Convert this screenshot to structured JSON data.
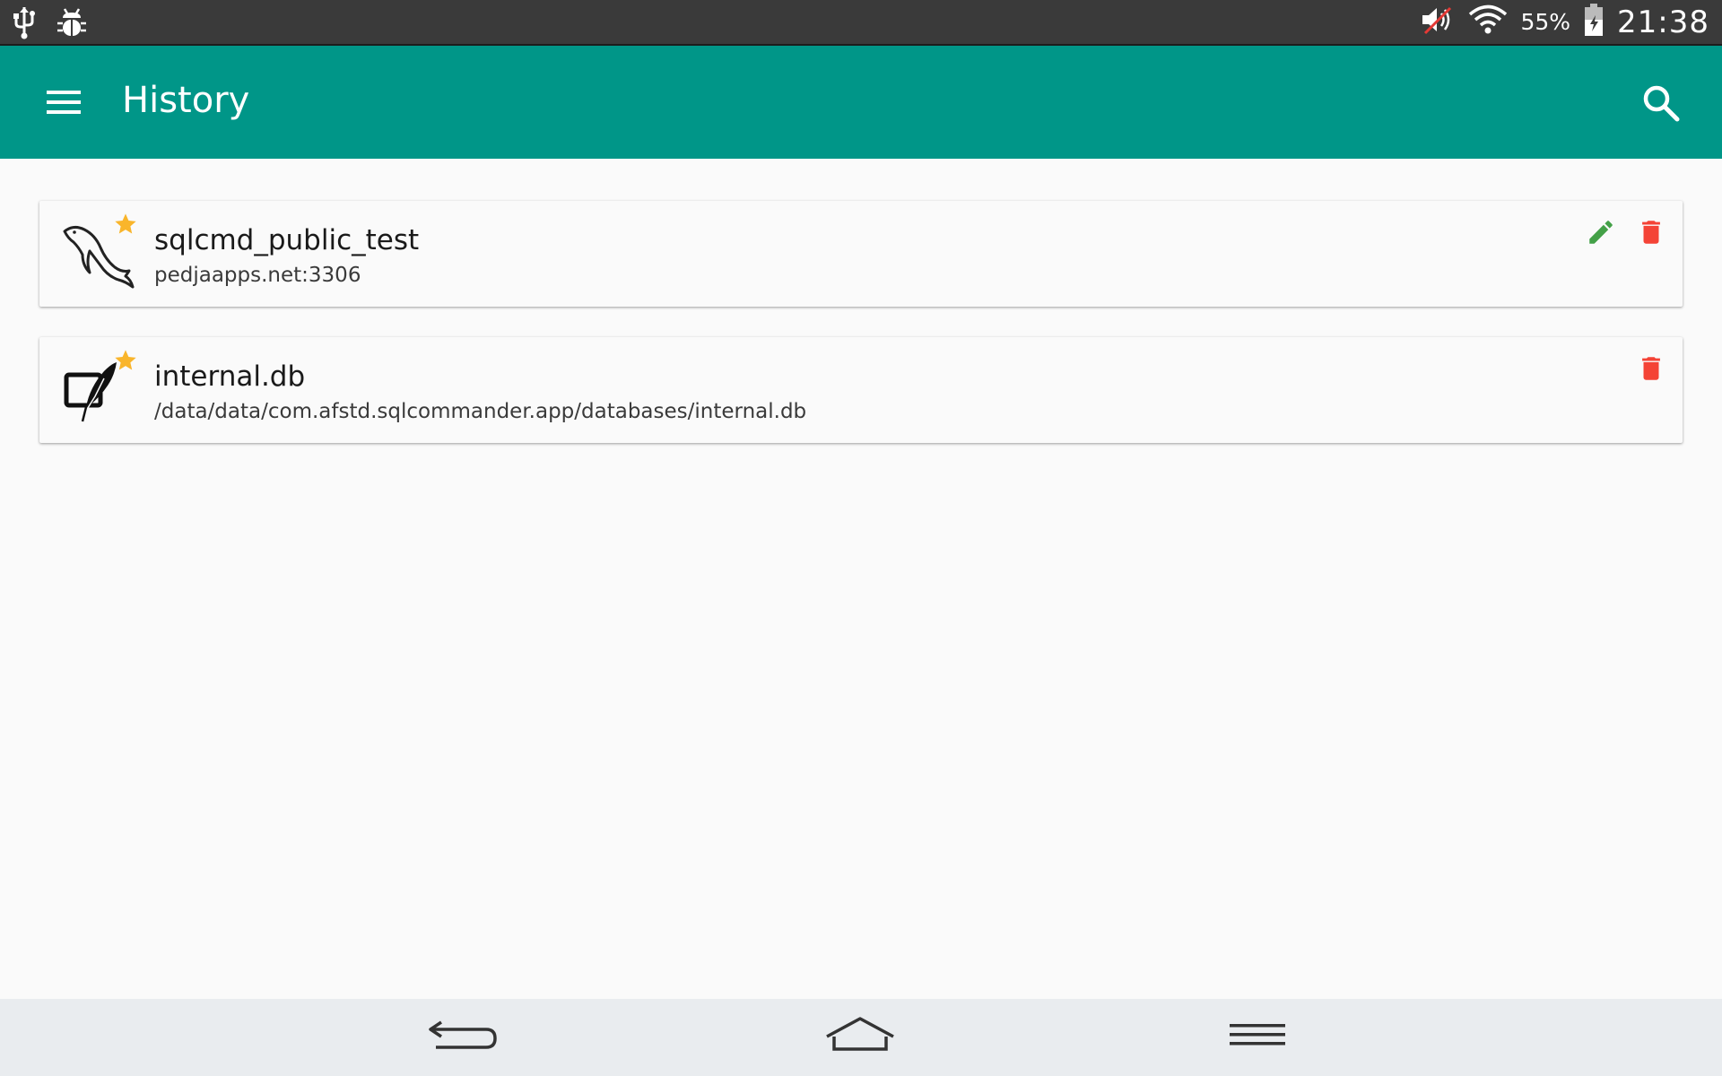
{
  "status_bar": {
    "left_icons": [
      "usb-icon",
      "debug-icon"
    ],
    "right_icons": [
      "volume-muted-icon",
      "wifi-icon",
      "battery-charging-icon"
    ],
    "battery_percent": "55%",
    "time": "21:38"
  },
  "app_bar": {
    "title": "History",
    "menu_icon": "hamburger-menu-icon",
    "search_icon": "search-icon",
    "background_color": "#009688"
  },
  "history": [
    {
      "name": "sqlcmd_public_test",
      "detail": "pedjaapps.net:3306",
      "type_icon": "mysql-dolphin-icon",
      "favorite": true,
      "actions": [
        "edit",
        "delete"
      ]
    },
    {
      "name": "internal.db",
      "detail": "/data/data/com.afstd.sqlcommander.app/databases/internal.db",
      "type_icon": "sqlite-feather-icon",
      "favorite": true,
      "actions": [
        "delete"
      ]
    }
  ],
  "colors": {
    "accent_star": "#f9b52b",
    "edit": "#43a047",
    "delete": "#f44336"
  },
  "nav_bar": {
    "buttons": [
      "back-icon",
      "home-icon",
      "menu-icon"
    ]
  }
}
